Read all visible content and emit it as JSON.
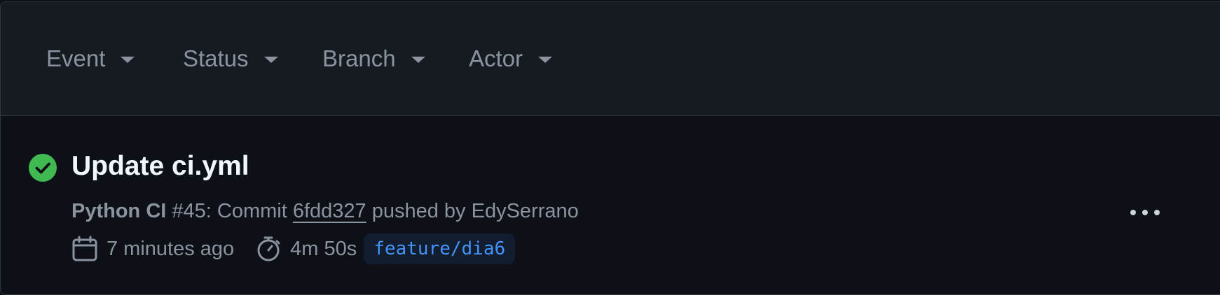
{
  "filters": {
    "event": "Event",
    "status": "Status",
    "branch": "Branch",
    "actor": "Actor"
  },
  "run": {
    "status": "success",
    "title": "Update ci.yml",
    "workflow": "Python CI",
    "meta_middle": " #45: Commit ",
    "commit_sha": "6fdd327",
    "meta_suffix": " pushed by EdySerrano",
    "time_ago": "7 minutes ago",
    "duration": "4m 50s",
    "branch": "feature/dia6"
  },
  "icons": {
    "status": "check-circle-fill-icon",
    "calendar": "calendar-icon",
    "stopwatch": "stopwatch-icon",
    "more": "kebab-horizontal-icon"
  },
  "colors": {
    "success": "#3fb950",
    "link_blue": "#4493f8",
    "muted": "#8b949e",
    "title": "#f0f6fc",
    "background": "#0d1117",
    "header_background": "#161b22"
  }
}
